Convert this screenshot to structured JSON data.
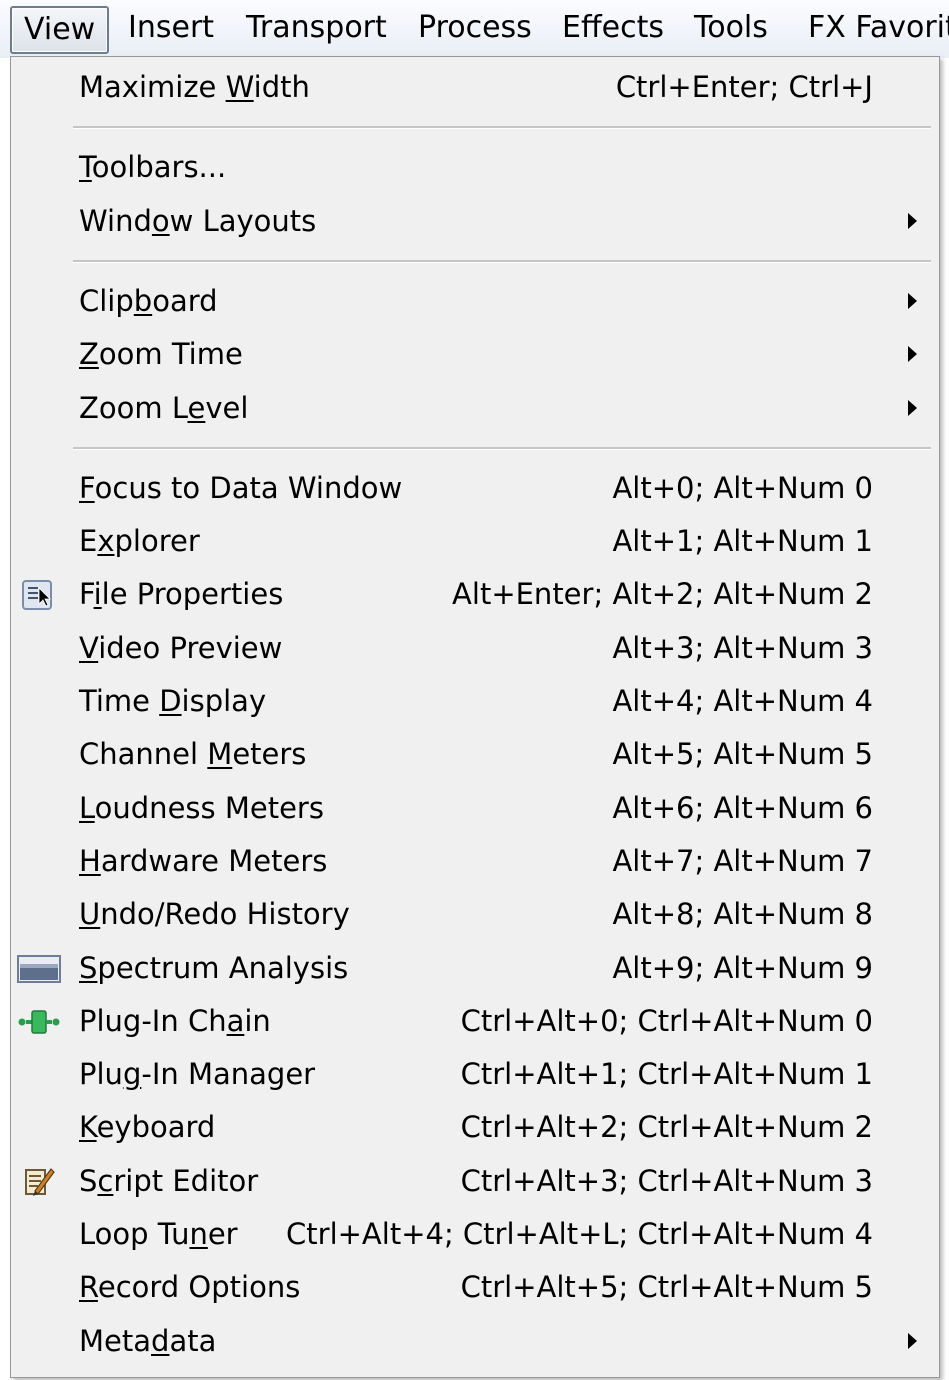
{
  "menubar": {
    "items": [
      "View",
      "Insert",
      "Transport",
      "Process",
      "Effects",
      "Tools",
      "FX Favorit"
    ]
  },
  "menu": {
    "items": [
      {
        "label": "Maximize Width",
        "mnemonic": "W",
        "shortcut": "Ctrl+Enter; Ctrl+J",
        "submenu": false
      },
      {
        "separator": true
      },
      {
        "label": "Toolbars...",
        "mnemonic": "T",
        "shortcut": "",
        "submenu": false
      },
      {
        "label": "Window Layouts",
        "mnemonic": "o",
        "shortcut": "",
        "submenu": true
      },
      {
        "separator": true
      },
      {
        "label": "Clipboard",
        "mnemonic": "b",
        "shortcut": "",
        "submenu": true
      },
      {
        "label": "Zoom Time",
        "mnemonic": "Z",
        "shortcut": "",
        "submenu": true
      },
      {
        "label": "Zoom Level",
        "mnemonic": "e",
        "shortcut": "",
        "submenu": true
      },
      {
        "separator": true
      },
      {
        "label": "Focus to Data Window",
        "mnemonic": "F",
        "shortcut": "Alt+0; Alt+Num 0",
        "submenu": false
      },
      {
        "label": "Explorer",
        "mnemonic": "x",
        "shortcut": "Alt+1; Alt+Num 1",
        "submenu": false
      },
      {
        "label": "File Properties",
        "mnemonic": "i",
        "shortcut": "Alt+Enter; Alt+2; Alt+Num 2",
        "submenu": false,
        "icon": "file-properties-icon"
      },
      {
        "label": "Video Preview",
        "mnemonic": "V",
        "shortcut": "Alt+3; Alt+Num 3",
        "submenu": false
      },
      {
        "label": "Time Display",
        "mnemonic": "D",
        "shortcut": "Alt+4; Alt+Num 4",
        "submenu": false
      },
      {
        "label": "Channel Meters",
        "mnemonic": "M",
        "shortcut": "Alt+5; Alt+Num 5",
        "submenu": false
      },
      {
        "label": "Loudness Meters",
        "mnemonic": "L",
        "shortcut": "Alt+6; Alt+Num 6",
        "submenu": false
      },
      {
        "label": "Hardware Meters",
        "mnemonic": "H",
        "shortcut": "Alt+7; Alt+Num 7",
        "submenu": false
      },
      {
        "label": "Undo/Redo History",
        "mnemonic": "U",
        "shortcut": "Alt+8; Alt+Num 8",
        "submenu": false
      },
      {
        "label": "Spectrum Analysis",
        "mnemonic": "S",
        "shortcut": "Alt+9; Alt+Num 9",
        "submenu": false,
        "icon": "spectrum-analysis-icon"
      },
      {
        "label": "Plug-In Chain",
        "mnemonic": "a",
        "shortcut": "Ctrl+Alt+0; Ctrl+Alt+Num 0",
        "submenu": false,
        "icon": "plugin-chain-icon"
      },
      {
        "label": "Plug-In Manager",
        "mnemonic": "g",
        "shortcut": "Ctrl+Alt+1; Ctrl+Alt+Num 1",
        "submenu": false
      },
      {
        "label": "Keyboard",
        "mnemonic": "K",
        "shortcut": "Ctrl+Alt+2; Ctrl+Alt+Num 2",
        "submenu": false
      },
      {
        "label": "Script Editor",
        "mnemonic": "c",
        "shortcut": "Ctrl+Alt+3; Ctrl+Alt+Num 3",
        "submenu": false,
        "icon": "script-editor-icon"
      },
      {
        "label": "Loop Tuner",
        "mnemonic": "n",
        "shortcut": "Ctrl+Alt+4; Ctrl+Alt+L; Ctrl+Alt+Num 4",
        "submenu": false
      },
      {
        "label": "Record Options",
        "mnemonic": "R",
        "shortcut": "Ctrl+Alt+5; Ctrl+Alt+Num 5",
        "submenu": false
      },
      {
        "label": "Metadata",
        "mnemonic": "d",
        "shortcut": "",
        "submenu": true
      }
    ]
  }
}
